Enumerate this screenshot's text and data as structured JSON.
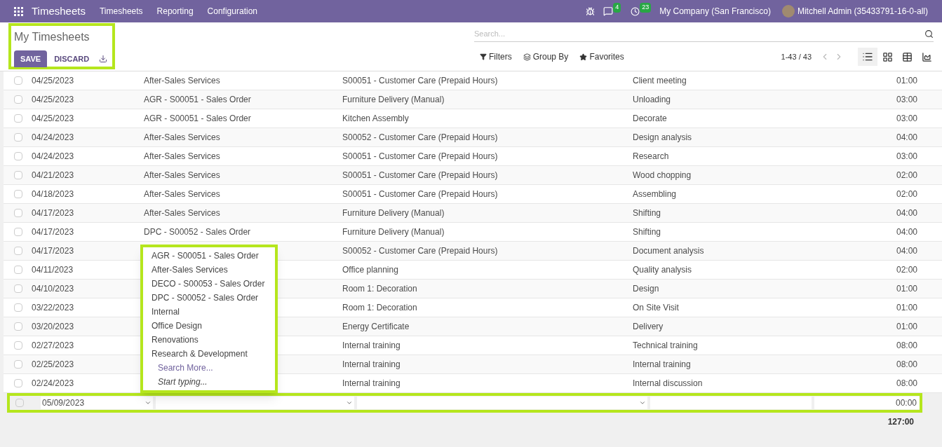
{
  "navbar": {
    "app_title": "Timesheets",
    "menu": [
      "Timesheets",
      "Reporting",
      "Configuration"
    ],
    "messages_badge": "4",
    "activities_badge": "23",
    "company": "My Company (San Francisco)",
    "user": "Mitchell Admin (35433791-16-0-all)"
  },
  "control_panel": {
    "title": "My Timesheets",
    "save": "SAVE",
    "discard": "DISCARD",
    "search": {
      "placeholder": "Search..."
    },
    "filters": "Filters",
    "group_by": "Group By",
    "favorites": "Favorites",
    "pager": "1-43 / 43",
    "views": [
      {
        "kind": "list",
        "selected": true
      },
      {
        "kind": "kanban",
        "selected": false
      },
      {
        "kind": "pivot",
        "selected": false
      },
      {
        "kind": "graph",
        "selected": false
      }
    ]
  },
  "rows": [
    {
      "date": "04/25/2023",
      "project": "After-Sales Services",
      "task": "S00051 - Customer Care (Prepaid Hours)",
      "description": "Client meeting",
      "hours": "01:00",
      "checked": false
    },
    {
      "date": "04/25/2023",
      "project": "AGR - S00051 - Sales Order",
      "task": "Furniture Delivery (Manual)",
      "description": "Unloading",
      "hours": "03:00",
      "checked": false
    },
    {
      "date": "04/25/2023",
      "project": "AGR - S00051 - Sales Order",
      "task": "Kitchen Assembly",
      "description": "Decorate",
      "hours": "03:00",
      "checked": false
    },
    {
      "date": "04/24/2023",
      "project": "After-Sales Services",
      "task": "S00052 - Customer Care (Prepaid Hours)",
      "description": "Design analysis",
      "hours": "04:00",
      "checked": false
    },
    {
      "date": "04/24/2023",
      "project": "After-Sales Services",
      "task": "S00051 - Customer Care (Prepaid Hours)",
      "description": "Research",
      "hours": "03:00",
      "checked": false
    },
    {
      "date": "04/21/2023",
      "project": "After-Sales Services",
      "task": "S00051 - Customer Care (Prepaid Hours)",
      "description": "Wood chopping",
      "hours": "02:00",
      "checked": false
    },
    {
      "date": "04/18/2023",
      "project": "After-Sales Services",
      "task": "S00051 - Customer Care (Prepaid Hours)",
      "description": "Assembling",
      "hours": "02:00",
      "checked": false
    },
    {
      "date": "04/17/2023",
      "project": "After-Sales Services",
      "task": "Furniture Delivery (Manual)",
      "description": "Shifting",
      "hours": "04:00",
      "checked": false
    },
    {
      "date": "04/17/2023",
      "project": "DPC - S00052 - Sales Order",
      "task": "Furniture Delivery (Manual)",
      "description": "Shifting",
      "hours": "04:00",
      "checked": false
    },
    {
      "date": "04/17/2023",
      "task": "S00052 - Customer Care (Prepaid Hours)",
      "description": "Document analysis",
      "hours": "04:00",
      "checked": false
    },
    {
      "date": "04/11/2023",
      "task": "Office planning",
      "description": "Quality analysis",
      "hours": "02:00",
      "checked": false
    },
    {
      "date": "04/10/2023",
      "task": "Room 1: Decoration",
      "description": "Design",
      "hours": "01:00",
      "checked": false
    },
    {
      "date": "03/22/2023",
      "task": "Room 1: Decoration",
      "description": "On Site Visit",
      "hours": "01:00",
      "checked": false
    },
    {
      "date": "03/20/2023",
      "task": "Energy Certificate",
      "description": "Delivery",
      "hours": "01:00",
      "checked": false
    },
    {
      "date": "02/27/2023",
      "task": "Internal training",
      "description": "Technical training",
      "hours": "08:00",
      "checked": false
    },
    {
      "date": "02/25/2023",
      "task": "Internal training",
      "description": "Internal training",
      "hours": "08:00",
      "checked": false
    },
    {
      "date": "02/24/2023",
      "task": "Internal training",
      "description": "Internal discussion",
      "hours": "08:00",
      "checked": false
    }
  ],
  "edit_row": {
    "date": "05/09/2023",
    "hours": "00:00",
    "checked": false
  },
  "project_dropdown": {
    "options": [
      "AGR - S00051 - Sales Order",
      "After-Sales Services",
      "DECO - S00053 - Sales Order",
      "DPC - S00052 - Sales Order",
      "Internal",
      "Office Design",
      "Renovations",
      "Research & Development"
    ],
    "search_more": "Search More...",
    "hint": "Start typing..."
  },
  "total": "127:00"
}
